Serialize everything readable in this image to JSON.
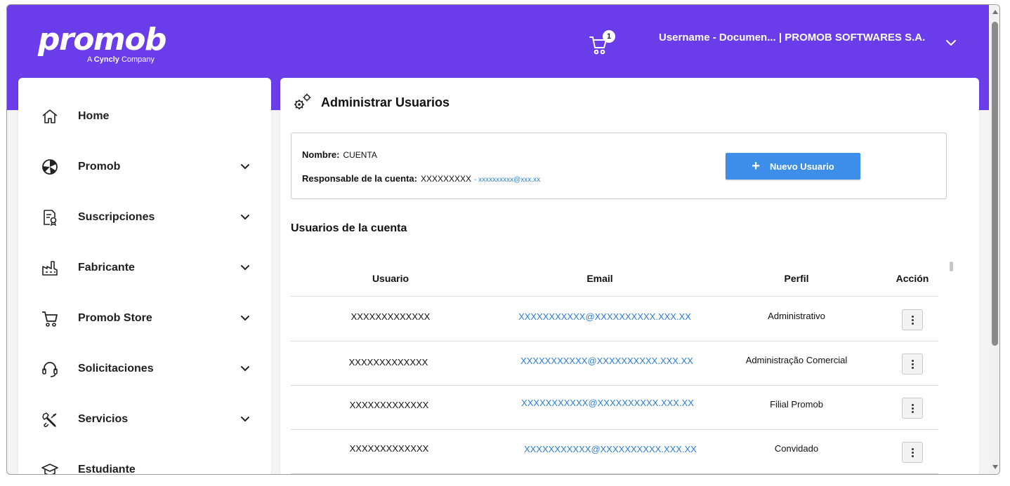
{
  "header": {
    "logo_text": "promob",
    "logo_sub_prefix": "A",
    "logo_sub_brand": "Cyncly",
    "logo_sub_suffix": "Company",
    "cart_count": "1",
    "user_label": "Username - Documen... | PROMOB SOFTWARES S.A.",
    "icons": {
      "cart": "cart-icon",
      "chevron": "chevron-down-icon"
    }
  },
  "sidebar": {
    "items": [
      {
        "label": "Home",
        "icon": "home-icon",
        "expandable": false
      },
      {
        "label": "Promob",
        "icon": "promob-icon",
        "expandable": true
      },
      {
        "label": "Suscripciones",
        "icon": "certificate-icon",
        "expandable": true
      },
      {
        "label": "Fabricante",
        "icon": "factory-icon",
        "expandable": true
      },
      {
        "label": "Promob Store",
        "icon": "cart-icon",
        "expandable": true
      },
      {
        "label": "Solicitaciones",
        "icon": "headset-icon",
        "expandable": true
      },
      {
        "label": "Servicios",
        "icon": "tools-icon",
        "expandable": true
      },
      {
        "label": "Estudiante",
        "icon": "graduation-cap-icon",
        "expandable": false
      }
    ]
  },
  "main": {
    "title": "Administrar Usuarios",
    "title_icon": "gears-icon",
    "account": {
      "name_label": "Nombre:",
      "name_value": "CUENTA",
      "owner_label": "Responsable de la cuenta:",
      "owner_value": "XXXXXXXXX",
      "owner_email": "- xxxxxxxxxx@xxx.xx"
    },
    "new_user_button": {
      "icon": "plus-icon",
      "label": "Nuevo Usuario"
    },
    "users_section_title": "Usuarios de la cuenta",
    "table": {
      "columns": [
        "Usuario",
        "Email",
        "Perfil",
        "Acción"
      ],
      "rows": [
        {
          "user": "XXXXXXXXXXXXX",
          "email": "XXXXXXXXXXX@XXXXXXXXXX.XXX.XX",
          "profile": "Administrativo"
        },
        {
          "user": "XXXXXXXXXXXXX",
          "email": "XXXXXXXXXXX@XXXXXXXXXX.XXX.XX",
          "profile": "Administração Comercial"
        },
        {
          "user": "XXXXXXXXXXXXX",
          "email": "XXXXXXXXXXX@XXXXXXXXXX.XXX.XX",
          "profile": "Filial Promob"
        },
        {
          "user": "XXXXXXXXXXXXX",
          "email": "XXXXXXXXXXX@XXXXXXXXXX.XXX.XX",
          "profile": "Convidado"
        }
      ],
      "action_icon": "kebab-menu-icon"
    }
  },
  "colors": {
    "brand": "#6a3cea",
    "primary_button": "#3d8ee8",
    "link": "#2d7fd4"
  }
}
